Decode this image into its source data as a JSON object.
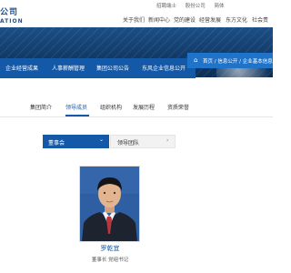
{
  "header": {
    "logo_text": "公司",
    "logo_sub": "ATION",
    "top_links": [
      "招聘端士",
      "股份公司",
      "简体"
    ],
    "nav": [
      "关于我们",
      "新闻中心",
      "党的建设",
      "经营发展",
      "东方文化",
      "社会责"
    ]
  },
  "banner": {
    "tabs": [
      "企业经营成果",
      "人事薪酬管理",
      "集团公司公告",
      "东风企业信息公开"
    ],
    "breadcrumb": "首页 / 信息公开 / 企业基本信息 / 领"
  },
  "subnav": {
    "items": [
      "集团简介",
      "领导成员",
      "组织机构",
      "发展历程",
      "资质荣誉"
    ],
    "active_index": 1
  },
  "filters": {
    "category": "董事会",
    "team": "领导团队"
  },
  "leader": {
    "name": "罗乾宜",
    "title": "董事长  党组书记"
  },
  "colors": {
    "accent": "#1458a8",
    "banner": "#123b6a",
    "link": "#1458a8"
  }
}
